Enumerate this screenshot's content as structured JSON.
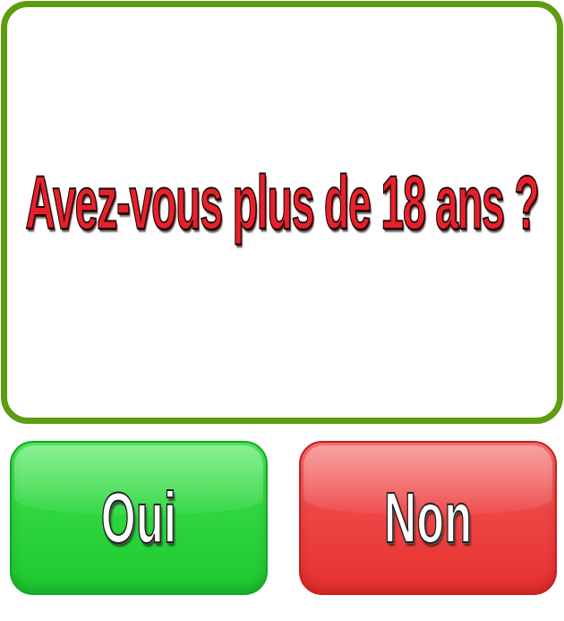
{
  "question": {
    "text": "Avez-vous plus de 18 ans ?"
  },
  "answers": {
    "yes_label": "Oui",
    "no_label": "Non"
  },
  "colors": {
    "panel_border": "#5e9c10",
    "question_text": "#e8202a",
    "yes_button": "#2fd63f",
    "no_button": "#ee4646",
    "button_text": "#ffffff"
  }
}
